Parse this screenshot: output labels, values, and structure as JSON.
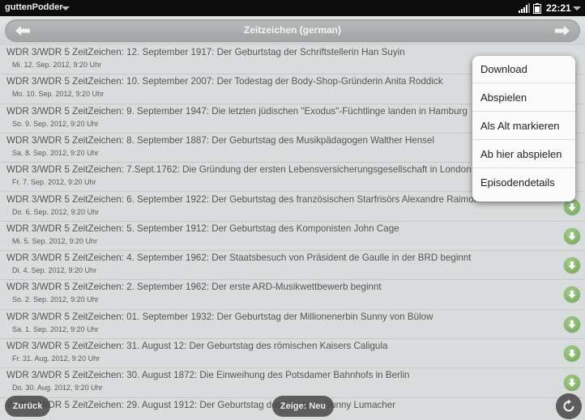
{
  "status_bar": {
    "app_name": "guttenPodder",
    "time": "22:21"
  },
  "header": {
    "title": "Zeitzeichen (german)"
  },
  "episodes": [
    {
      "title": "WDR 3/WDR 5 ZeitZeichen: 12. September 1917: Der Geburtstag der Schriftstellerin Han Suyin",
      "date": "Mi. 12. Sep. 2012, 9:20 Uhr"
    },
    {
      "title": "WDR 3/WDR 5 ZeitZeichen: 10. September 2007: Der Todestag der Body-Shop-Gründerin Anita Roddick",
      "date": "Mo. 10. Sep. 2012, 9:20 Uhr"
    },
    {
      "title": "WDR 3/WDR 5 ZeitZeichen: 9. September 1947: Die letzten jüdischen \"Exodus\"-Füchtlinge landen in Hamburg",
      "date": "So. 9. Sep. 2012, 9:20 Uhr"
    },
    {
      "title": "WDR 3/WDR 5 ZeitZeichen: 8. September 1887: Der Geburtstag des Musikpädagogen Walther Hensel",
      "date": "Sa. 8. Sep. 2012, 9:20 Uhr"
    },
    {
      "title": "WDR 3/WDR 5 ZeitZeichen: 7.Sept.1762: Die Gründung der ersten Lebensversicherungsgesellschaft in London",
      "date": "Fr. 7. Sep. 2012, 9:20 Uhr"
    },
    {
      "title": "WDR 3/WDR 5 ZeitZeichen: 6. September 1922: Der Geburtstag des französischen Starfrisörs Alexandre Raimon",
      "date": "Do. 6. Sep. 2012, 9:20 Uhr"
    },
    {
      "title": "WDR 3/WDR 5 ZeitZeichen: 5. September 1912: Der Geburtstag des Komponisten John Cage",
      "date": "Mi. 5. Sep. 2012, 9:20 Uhr"
    },
    {
      "title": "WDR 3/WDR 5 ZeitZeichen: 4. September 1962: Der Staatsbesuch von Präsident de Gaulle in der BRD beginnt",
      "date": "Di. 4. Sep. 2012, 9:20 Uhr"
    },
    {
      "title": "WDR 3/WDR 5 ZeitZeichen: 2. September 1962: Der erste ARD-Musikwettbewerb beginnt",
      "date": "So. 2. Sep. 2012, 9:20 Uhr"
    },
    {
      "title": "WDR 3/WDR 5 ZeitZeichen: 01. September 1932: Der Geburtstag der Millionenerbin Sunny von Bülow",
      "date": "Sa. 1. Sep. 2012, 9:20 Uhr"
    },
    {
      "title": "WDR 3/WDR 5 ZeitZeichen: 31. August 12: Der Geburtstag des römischen Kaisers Caligula",
      "date": "Fr. 31. Aug. 2012, 9:20 Uhr"
    },
    {
      "title": "WDR 3/WDR 5 ZeitZeichen: 30. August 1872: Die Einweihung des Potsdamer Bahnhofs in Berlin",
      "date": "Do. 30. Aug. 2012, 9:20 Uhr"
    },
    {
      "title": "WDR 3/WDR 5 ZeitZeichen: 29. August 1912: Der Geburtstag des Musikers Sunny Lumacher",
      "date": ""
    }
  ],
  "context_menu": {
    "items": [
      "Download",
      "Abspielen",
      "Als Alt markieren",
      "Ab hier abspielen",
      "Episodendetails"
    ]
  },
  "toolbar": {
    "back_label": "Zurück",
    "filter_label": "Zeige: Neu"
  },
  "icons": {
    "download": "download-arrow-icon",
    "refresh": "refresh-icon",
    "prev": "arrow-left-icon",
    "next": "arrow-right-icon"
  },
  "colors": {
    "download_green": "#7fb464",
    "status_bar": "#0d0d0d",
    "header_bar": "#a9aeae"
  }
}
